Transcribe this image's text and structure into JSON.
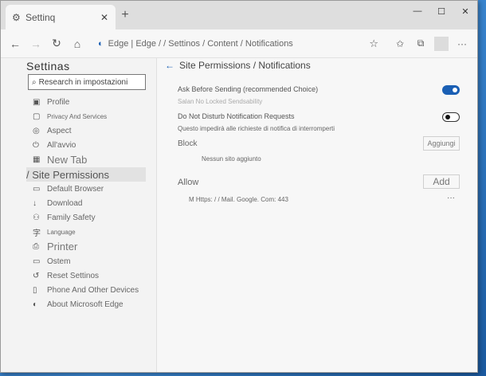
{
  "tab": {
    "title": "Settinq",
    "close": "✕",
    "new": "+"
  },
  "window_controls": {
    "minimize": "—",
    "maximize": "☐",
    "close": "✕"
  },
  "address": {
    "text": "Edge | Edge / / Settinos / Content / Notifications"
  },
  "sidebar": {
    "title": "Settinas",
    "search_placeholder": "Research in impostazioni",
    "items": [
      {
        "label": "Profile"
      },
      {
        "label": "Privacy And Services"
      },
      {
        "label": "Aspect"
      },
      {
        "label": "All'avvio"
      },
      {
        "label": "New Tab"
      },
      {
        "label": "/ Site Permissions"
      },
      {
        "label": "Default Browser"
      },
      {
        "label": "Download"
      },
      {
        "label": "Family Safety"
      },
      {
        "label": "Language"
      },
      {
        "label": "Printer"
      },
      {
        "label": "Ostem"
      },
      {
        "label": "Reset Settinos"
      },
      {
        "label": "Phone And Other Devices"
      },
      {
        "label": "About Microsoft Edge"
      }
    ]
  },
  "main": {
    "title": "Site Permissions / Notifications",
    "ask_label": "Ask Before Sending (recommended Choice)",
    "ask_sub": "Salan No Locked Sendsability",
    "dnd_label": "Do Not Disturb Notification Requests",
    "dnd_sub": "Questo impedirà alle richieste di notifica di interromperti",
    "block_title": "Block",
    "block_button": "Aggiungi",
    "block_empty": "Nessun sito aggiunto",
    "allow_title": "Allow",
    "allow_button": "Add",
    "allow_site": "M Https: / / Mail. Google. Com: 443",
    "more": "···"
  },
  "colors": {
    "accent": "#1a5fb4"
  }
}
